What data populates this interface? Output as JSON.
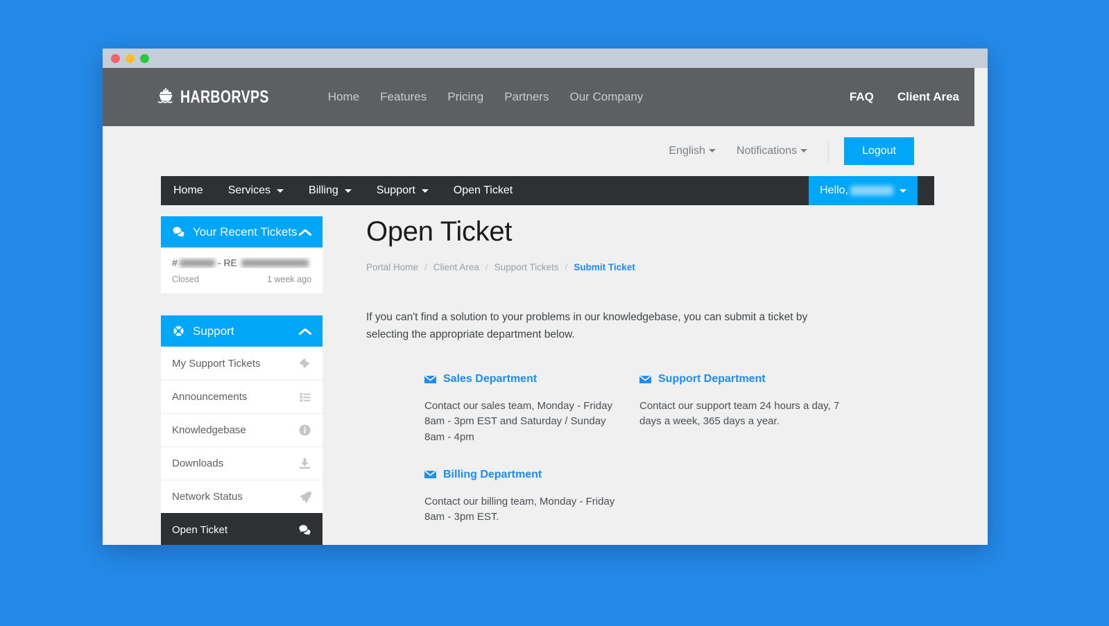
{
  "window": {
    "traffic_lights": [
      "close",
      "minimize",
      "maximize"
    ]
  },
  "site_header": {
    "brand": "HARBORVPS",
    "brand_icon": "ship-icon",
    "nav": [
      {
        "label": "Home"
      },
      {
        "label": "Features"
      },
      {
        "label": "Pricing"
      },
      {
        "label": "Partners"
      },
      {
        "label": "Our Company"
      }
    ],
    "nav_right": [
      {
        "label": "FAQ"
      },
      {
        "label": "Client Area"
      }
    ]
  },
  "util_bar": {
    "language": "English",
    "notifications": "Notifications",
    "logout": "Logout"
  },
  "main_nav": {
    "items": [
      {
        "label": "Home",
        "has_caret": false
      },
      {
        "label": "Services",
        "has_caret": true
      },
      {
        "label": "Billing",
        "has_caret": true
      },
      {
        "label": "Support",
        "has_caret": true
      },
      {
        "label": "Open Ticket",
        "has_caret": false
      }
    ],
    "user_greeting": "Hello,",
    "user_name_redacted": true
  },
  "sidebar": {
    "recent_tickets": {
      "title": "Your Recent Tickets",
      "icon": "comments-icon",
      "collapse_icon": "chevron-up-icon",
      "tickets": [
        {
          "id_redacted": "#",
          "subject_prefix": "- RE",
          "subject_redacted": true,
          "status": "Closed",
          "age": "1 week ago"
        }
      ]
    },
    "support": {
      "title": "Support",
      "icon": "lifebuoy-icon",
      "collapse_icon": "chevron-up-icon",
      "items": [
        {
          "label": "My Support Tickets",
          "icon": "ticket-icon",
          "active": false
        },
        {
          "label": "Announcements",
          "icon": "list-icon",
          "active": false
        },
        {
          "label": "Knowledgebase",
          "icon": "info-circle-icon",
          "active": false
        },
        {
          "label": "Downloads",
          "icon": "download-icon",
          "active": false
        },
        {
          "label": "Network Status",
          "icon": "rocket-icon",
          "active": false
        },
        {
          "label": "Open Ticket",
          "icon": "comments-icon",
          "active": true
        }
      ]
    }
  },
  "main": {
    "title": "Open Ticket",
    "breadcrumb": [
      {
        "label": "Portal Home",
        "current": false
      },
      {
        "label": "Client Area",
        "current": false
      },
      {
        "label": "Support Tickets",
        "current": false
      },
      {
        "label": "Submit Ticket",
        "current": true
      }
    ],
    "intro": "If you can't find a solution to your problems in our knowledgebase, you can submit a ticket by selecting the appropriate department below.",
    "departments": [
      {
        "name": "Sales Department",
        "icon": "envelope-icon",
        "description": "Contact our sales team, Monday - Friday 8am - 3pm EST and Saturday / Sunday 8am - 4pm"
      },
      {
        "name": "Support Department",
        "icon": "envelope-icon",
        "description": "Contact our support team 24 hours a day, 7 days a week, 365 days a year."
      },
      {
        "name": "Billing Department",
        "icon": "envelope-icon",
        "description": "Contact our billing team, Monday - Friday 8am - 3pm EST."
      }
    ]
  },
  "colors": {
    "accent_blue": "#00a6f7",
    "link_blue": "#1b8cf3",
    "header_gray": "#5c6063",
    "nav_dark": "#2e3133",
    "desktop_blue": "#2489e8",
    "page_bg": "#f0f0f0"
  }
}
